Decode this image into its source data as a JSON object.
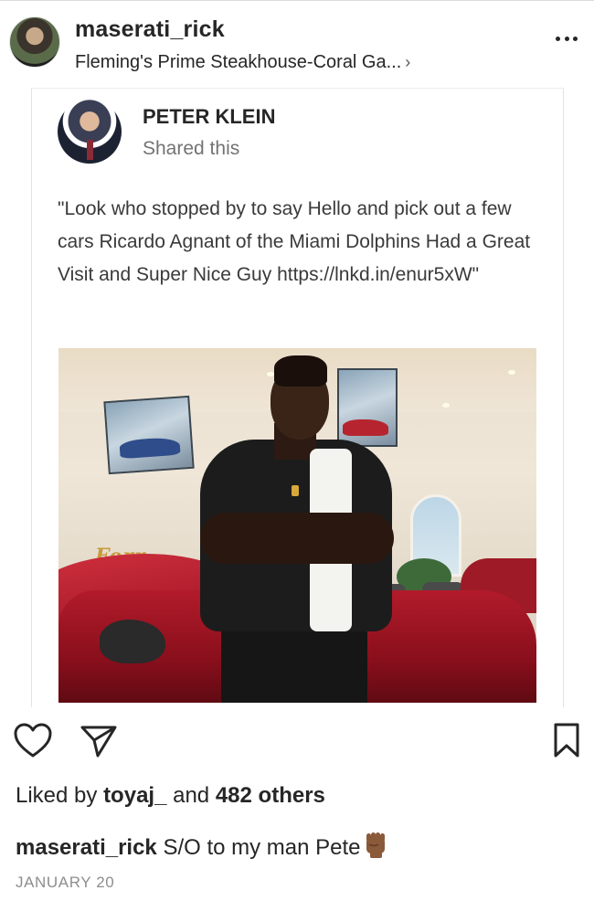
{
  "post": {
    "username": "maserati_rick",
    "location": "Fleming's Prime Steakhouse-Coral Ga...",
    "location_chevron": "›"
  },
  "shared": {
    "author": "PETER KLEIN",
    "subtitle": "Shared this",
    "text": "\"Look who stopped by to say Hello and pick out a few cars Ricardo Agnant of the Miami Dolphins Had a Great Visit and Super Nice Guy https://lnkd.in/enur5xW\"",
    "photo_sign": "Ferr"
  },
  "likes": {
    "prefix": "Liked by ",
    "user": "toyaj_",
    "middle": " and ",
    "count": "482 others"
  },
  "caption": {
    "username": "maserati_rick",
    "text": " S/O to my man Pete"
  },
  "date": "JANUARY 20",
  "icons": {
    "more": "more-options-icon",
    "like": "heart-icon",
    "share": "paper-plane-icon",
    "save": "bookmark-icon",
    "emoji": "raised-fist-emoji"
  },
  "colors": {
    "text": "#262626",
    "secondary": "#8e8e8e",
    "car_red": "#b21b2a"
  }
}
